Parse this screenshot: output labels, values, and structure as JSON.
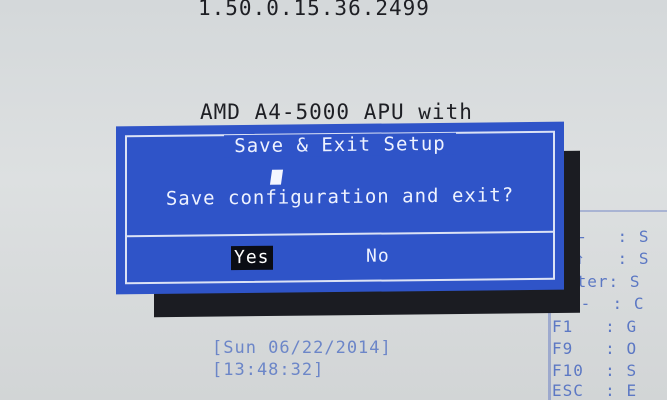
{
  "background": {
    "version": "1.50.0.15.36.2499",
    "cpu": "AMD A4-5000 APU with",
    "date": "[Sun 06/22/2014]",
    "time": "[13:48:32]"
  },
  "help_keys": [
    {
      "key": "←",
      "sep": ":",
      "text": "S"
    },
    {
      "key": "↑",
      "sep": ":",
      "text": "S"
    },
    {
      "key": "nter",
      "sep": ":",
      "text": "S"
    },
    {
      "key": "/-",
      "sep": ":",
      "text": "C"
    },
    {
      "key": "F1",
      "sep": ":",
      "text": "G"
    },
    {
      "key": "F9",
      "sep": ":",
      "text": "O"
    },
    {
      "key": "F10",
      "sep": ":",
      "text": "S"
    },
    {
      "key": "ESC",
      "sep": ":",
      "text": "E"
    }
  ],
  "dialog": {
    "title": "Save & Exit Setup",
    "message": "Save configuration and exit?",
    "yes_label": "Yes",
    "no_label": "No"
  },
  "colors": {
    "dialog_bg": "#2f54c8",
    "dialog_text": "#eef2ff",
    "selected_bg": "#0a0c14",
    "help_text": "#5c78c4"
  }
}
